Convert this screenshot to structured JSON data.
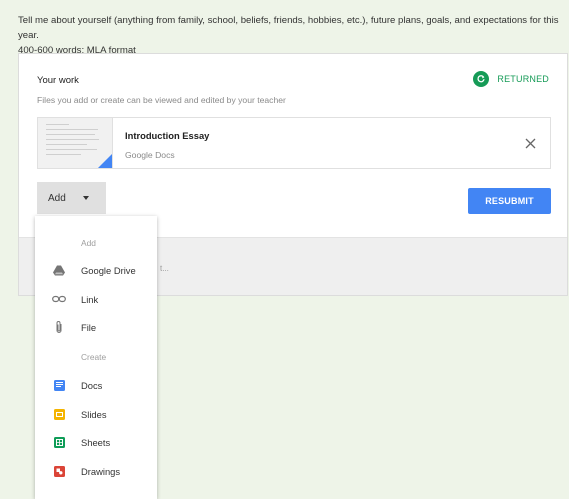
{
  "instructions": {
    "line1": "Tell me about yourself (anything from family, school, beliefs, friends, hobbies, etc.), future plans, goals, and expectations for this year.",
    "line2": "400-600 words; MLA format"
  },
  "work": {
    "title": "Your work",
    "subtitle": "Files you add or create can be viewed and edited by your teacher",
    "status": "RETURNED",
    "status_color": "#169b57",
    "attachment": {
      "title": "Introduction Essay",
      "type": "Google Docs",
      "thumb_icon": "doc-thumbnail",
      "remove_icon": "close-icon"
    },
    "add_label": "Add",
    "resubmit_label": "RESUBMIT",
    "accent_color": "#4285f4",
    "behind_text": "t..."
  },
  "add_menu": {
    "add_header": "Add",
    "add_items": [
      {
        "label": "Google Drive",
        "icon": "google-drive-icon"
      },
      {
        "label": "Link",
        "icon": "link-icon"
      },
      {
        "label": "File",
        "icon": "paperclip-icon"
      }
    ],
    "create_header": "Create",
    "create_items": [
      {
        "label": "Docs",
        "icon": "docs-icon",
        "color": "#4285f4"
      },
      {
        "label": "Slides",
        "icon": "slides-icon",
        "color": "#f4b400"
      },
      {
        "label": "Sheets",
        "icon": "sheets-icon",
        "color": "#0f9d58"
      },
      {
        "label": "Drawings",
        "icon": "drawings-icon",
        "color": "#db4437"
      }
    ]
  }
}
